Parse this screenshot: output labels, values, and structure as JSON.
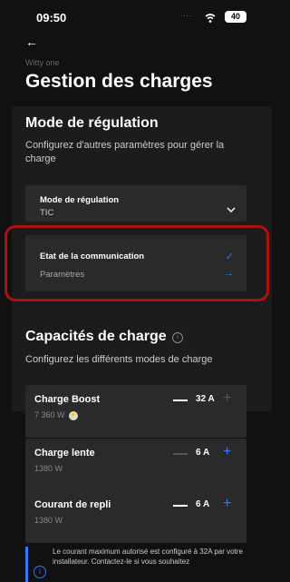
{
  "status": {
    "time": "09:50",
    "signal": "....",
    "battery": "40"
  },
  "header": {
    "back_icon": "arrow-left-icon",
    "breadcrumb": "Witty one",
    "title": "Gestion des charges"
  },
  "regulation": {
    "title": "Mode de régulation",
    "description": "Configurez d'autres paramètres pour gérer la charge",
    "mode_label": "Mode de régulation",
    "mode_value": "TIC",
    "comm_label": "Etat de la communication",
    "comm_sub": "Paramètres"
  },
  "capacities": {
    "title": "Capacités de charge",
    "description": "Configurez les différents modes de charge",
    "items": [
      {
        "name": "Charge Boost",
        "power": "7 360 W",
        "amp": "32 A"
      },
      {
        "name": "Charge lente",
        "power": "1380 W",
        "amp": "6 A"
      },
      {
        "name": "Courant de repli",
        "power": "1380 W",
        "amp": "6 A"
      }
    ]
  },
  "note": {
    "text": "Le courant maximum autorisé est configuré à 32A par votre installateur. Contactez-le si vous souhaitez"
  },
  "colors": {
    "accent": "#2f7cf6",
    "background": "#111111",
    "card": "#2a2a2c",
    "highlight": "#b01010"
  }
}
